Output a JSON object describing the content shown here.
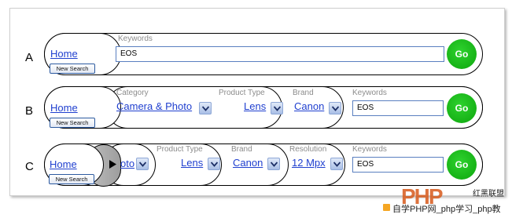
{
  "rows": {
    "a": {
      "label": "A",
      "home": "Home",
      "new_search": "New Search",
      "keywords_label": "Keywords",
      "keywords_value": "EOS",
      "go": "Go"
    },
    "b": {
      "label": "B",
      "home": "Home",
      "new_search": "New Search",
      "category_label": "Category",
      "category_value": "Camera & Photo",
      "product_type_label": "Product Type",
      "product_type_value": "Lens",
      "brand_label": "Brand",
      "brand_value": "Canon",
      "keywords_label": "Keywords",
      "keywords_value": "EOS",
      "go": "Go"
    },
    "c": {
      "label": "C",
      "home": "Home",
      "new_search": "New Search",
      "truncated_category_value": "oto",
      "product_type_label": "Product Type",
      "product_type_value": "Lens",
      "brand_label": "Brand",
      "brand_value": "Canon",
      "resolution_label": "Resolution",
      "resolution_value": "12 Mpx",
      "keywords_label": "Keywords",
      "keywords_value": "EOS",
      "go": "Go"
    }
  },
  "watermark": {
    "logo": "PHP",
    "tagline": "红黑联盟",
    "text": "自学PHP网_php学习_php教"
  },
  "colors": {
    "link": "#1f3fcf",
    "go_button": "#12b012",
    "label_gray": "#8c8c8c"
  },
  "icons": {
    "dropdown": "chevron-down-icon",
    "back_arrow": "triangle-right-icon"
  }
}
